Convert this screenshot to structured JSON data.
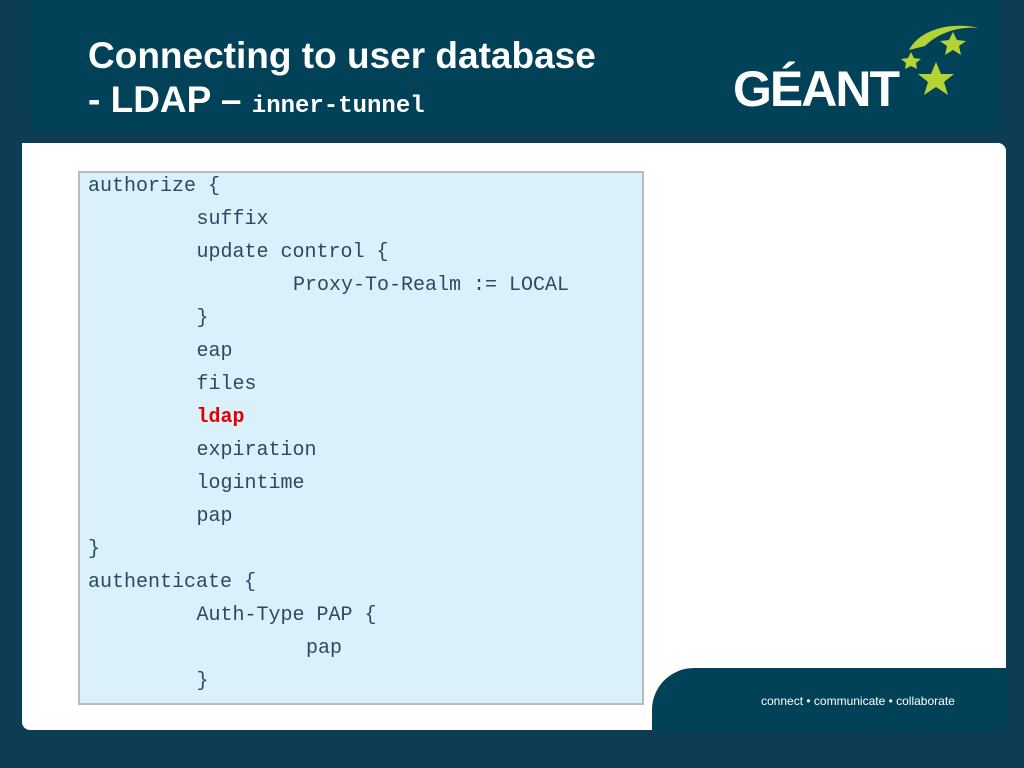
{
  "slide": {
    "title_line1": "Connecting to user database",
    "title_line2_prefix": "- LDAP – ",
    "title_line2_code": "inner-tunnel"
  },
  "logo": {
    "text": "GÉANT",
    "icon": "star-icon"
  },
  "footer": {
    "tagline": "connect • communicate • collaborate"
  },
  "code": {
    "highlight_color": "#e00000",
    "lines": [
      {
        "text": "authorize {",
        "indent": 0
      },
      {
        "text": "suffix",
        "indent": 1
      },
      {
        "text": "update control {",
        "indent": 1
      },
      {
        "text": "Proxy-To-Realm := LOCAL",
        "indent": 2
      },
      {
        "text": "}",
        "indent": 1
      },
      {
        "text": "eap",
        "indent": 1
      },
      {
        "text": "files",
        "indent": 1
      },
      {
        "text": "ldap",
        "indent": 1,
        "highlight": true
      },
      {
        "text": "expiration",
        "indent": 1
      },
      {
        "text": "logintime",
        "indent": 1
      },
      {
        "text": "pap",
        "indent": 1
      },
      {
        "text": "}",
        "indent": 0
      },
      {
        "text": "authenticate {",
        "indent": 0
      },
      {
        "text": "Auth-Type PAP {",
        "indent": 1
      },
      {
        "text": "pap",
        "indent": 2
      },
      {
        "text": "}",
        "indent": 1
      }
    ]
  }
}
